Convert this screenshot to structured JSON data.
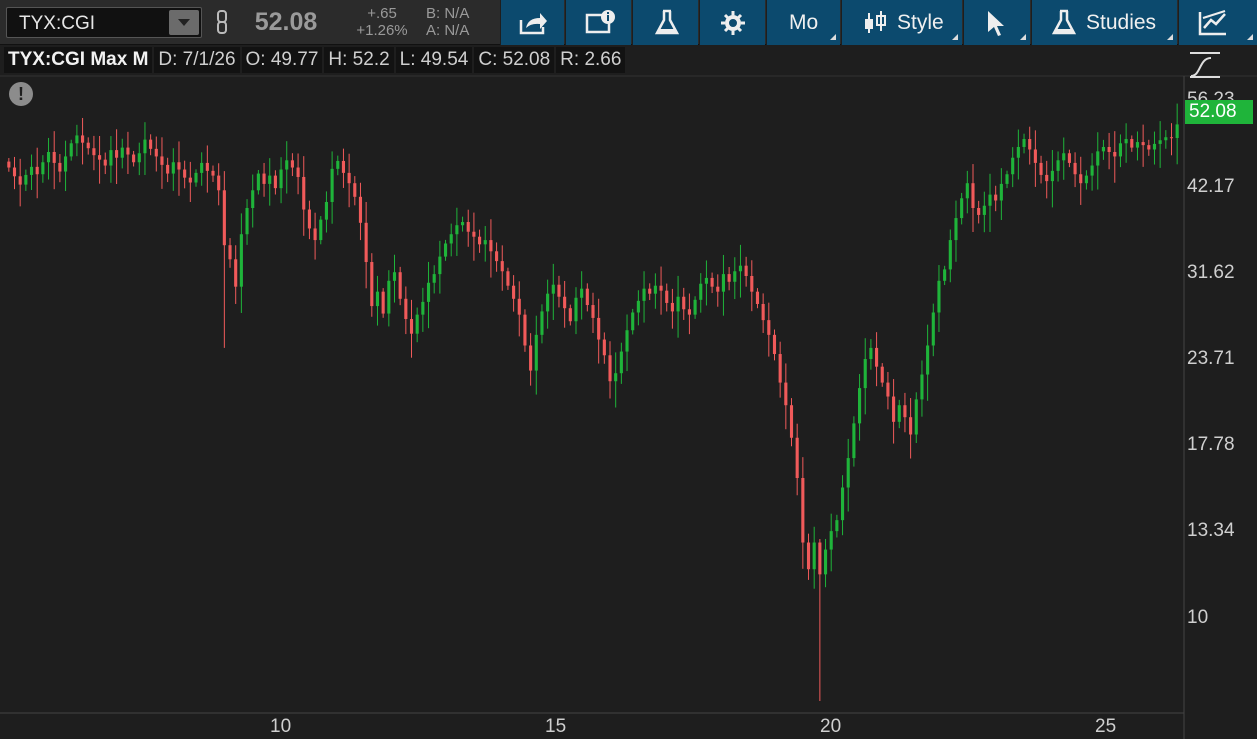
{
  "toolbar": {
    "symbol": "TYX:CGI",
    "last": "52.08",
    "change": "+.65",
    "change_pct": "+1.26%",
    "bid": "B: N/A",
    "ask": "A: N/A",
    "aggregation": "Mo",
    "style_label": "Style",
    "studies_label": "Studies"
  },
  "info": {
    "title": "TYX:CGI Max M",
    "date": "D: 7/1/26",
    "open": "O: 49.77",
    "high": "H: 52.2",
    "low": "L: 49.54",
    "close": "C: 52.08",
    "range": "R: 2.66"
  },
  "alert_icon": "!",
  "colors": {
    "up": "#1fb43a",
    "down": "#f05a5a",
    "background": "#1e1e1e",
    "button": "#0c4a6e"
  },
  "chart_data": {
    "type": "candlestick",
    "title": "TYX:CGI Max M",
    "y_scale": "log",
    "y_ticks": [
      "56.23",
      "42.17",
      "31.62",
      "23.71",
      "17.78",
      "13.34",
      "10"
    ],
    "x_ticks": [
      "10",
      "15",
      "20",
      "25"
    ],
    "last_price_label": "52.08",
    "ylim": [
      7.5,
      60
    ],
    "closes": [
      45.1,
      43.8,
      42.6,
      44.0,
      45.2,
      44.1,
      45.9,
      47.5,
      45.8,
      44.5,
      46.8,
      48.9,
      50.2,
      49.0,
      48.1,
      47.0,
      46.3,
      45.4,
      47.8,
      46.6,
      48.2,
      47.1,
      45.9,
      47.3,
      49.5,
      48.0,
      46.8,
      45.5,
      44.2,
      45.9,
      44.8,
      43.6,
      42.9,
      44.3,
      45.8,
      44.6,
      43.9,
      41.8,
      34.8,
      33.2,
      30.3,
      36.1,
      39.4,
      41.8,
      44.2,
      42.7,
      43.9,
      42.1,
      44.8,
      46.2,
      45.1,
      43.7,
      39.2,
      36.8,
      35.4,
      37.9,
      40.2,
      44.9,
      46.1,
      44.3,
      42.8,
      40.9,
      37.5,
      32.9,
      28.4,
      29.8,
      27.7,
      30.9,
      31.8,
      29.1,
      27.2,
      25.9,
      27.6,
      28.8,
      30.7,
      31.6,
      33.5,
      35.0,
      36.1,
      37.2,
      37.6,
      36.4,
      35.8,
      34.9,
      35.4,
      34.1,
      33.0,
      31.9,
      30.4,
      29.1,
      27.6,
      24.9,
      22.9,
      25.8,
      27.9,
      29.6,
      30.5,
      29.3,
      28.2,
      27.0,
      29.2,
      30.1,
      28.5,
      27.3,
      25.4,
      24.1,
      22.1,
      22.7,
      24.4,
      26.2,
      27.8,
      28.9,
      30.1,
      29.6,
      30.4,
      29.9,
      28.7,
      27.9,
      29.3,
      28.1,
      27.6,
      29.0,
      30.6,
      31.2,
      30.3,
      29.8,
      31.6,
      30.8,
      31.9,
      32.5,
      31.4,
      29.8,
      28.6,
      27.1,
      25.8,
      24.2,
      22.0,
      20.4,
      18.3,
      16.0,
      12.9,
      11.8,
      12.9,
      11.6,
      12.6,
      13.4,
      13.9,
      15.5,
      17.1,
      19.2,
      21.6,
      23.8,
      24.7,
      23.2,
      22.0,
      21.0,
      19.3,
      20.4,
      19.6,
      18.5,
      20.8,
      22.6,
      24.9,
      27.8,
      30.9,
      32.1,
      35.4,
      38.1,
      40.7,
      42.8,
      39.4,
      38.5,
      39.7,
      41.2,
      40.4,
      42.7,
      44.1,
      46.6,
      48.3,
      49.6,
      47.9,
      45.8,
      44.0,
      43.1,
      44.6,
      46.2,
      47.3,
      45.8,
      44.1,
      42.8,
      43.9,
      45.4,
      47.6,
      48.3,
      47.5,
      46.8,
      48.9,
      49.6,
      48.2,
      49.1,
      48.6,
      47.9,
      48.8,
      49.4,
      49.9,
      49.77,
      52.08
    ]
  }
}
